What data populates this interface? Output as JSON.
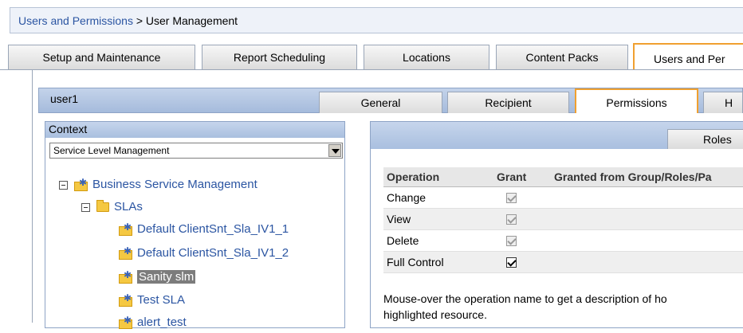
{
  "breadcrumb": {
    "parent": "Users and Permissions",
    "separator": ">",
    "current": "User Management"
  },
  "top_tabs": [
    {
      "label": "Setup and Maintenance"
    },
    {
      "label": "Report Scheduling"
    },
    {
      "label": "Locations"
    },
    {
      "label": "Content Packs"
    },
    {
      "label": "Users and Per",
      "active": true
    }
  ],
  "user": {
    "name": "user1"
  },
  "sub_tabs": [
    {
      "label": "General"
    },
    {
      "label": "Recipient"
    },
    {
      "label": "Permissions",
      "active": true
    },
    {
      "label": "H"
    }
  ],
  "context": {
    "title": "Context",
    "selected_value": "Service Level Management",
    "tree": [
      {
        "label": "Business Service Management",
        "icon": "star-folder-icon",
        "toggle": "minus"
      },
      {
        "label": "SLAs",
        "icon": "folder-icon",
        "toggle": "minus"
      },
      {
        "label": "Default ClientSnt_Sla_IV1_1",
        "icon": "star-folder-icon"
      },
      {
        "label": "Default ClientSnt_Sla_IV1_2",
        "icon": "star-folder-icon"
      },
      {
        "label": "Sanity slm",
        "icon": "star-folder-icon",
        "selected": true
      },
      {
        "label": "Test SLA",
        "icon": "star-folder-icon"
      },
      {
        "label": "alert_test",
        "icon": "star-folder-icon"
      }
    ]
  },
  "permissions": {
    "roles_tab": "Roles",
    "columns": [
      "Operation",
      "Grant",
      "Granted from Group/Roles/Pa"
    ],
    "rows": [
      {
        "operation": "Change",
        "grant": true,
        "enabled": false
      },
      {
        "operation": "View",
        "grant": true,
        "enabled": false
      },
      {
        "operation": "Delete",
        "grant": true,
        "enabled": false
      },
      {
        "operation": "Full Control",
        "grant": true,
        "enabled": true
      }
    ],
    "help_line1": "Mouse-over the operation name to get a description of ho",
    "help_line2": "highlighted resource."
  },
  "colors": {
    "link": "#2b55a2",
    "active_tab_border": "#f0a030",
    "header_blue": "#a9bfdf"
  }
}
